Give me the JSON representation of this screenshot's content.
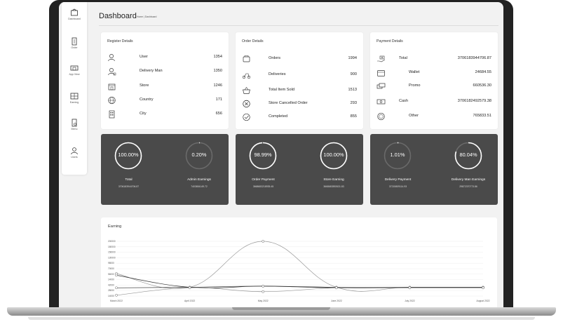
{
  "page": {
    "title": "Dashboard",
    "breadcrumb": "Home  |  Dashboard"
  },
  "sidebar": [
    {
      "label": "Dashboard",
      "icon": "dashboard-icon"
    },
    {
      "label": "Order",
      "icon": "order-icon"
    },
    {
      "label": "App View",
      "icon": "app-view-icon"
    },
    {
      "label": "Earning",
      "icon": "earning-icon"
    },
    {
      "label": "Menu",
      "icon": "menu-icon"
    },
    {
      "label": "Users",
      "icon": "users-icon"
    }
  ],
  "register": {
    "title": "Register Details",
    "rows": [
      {
        "label": "User",
        "value": "1354",
        "icon": "user-icon"
      },
      {
        "label": "Delivery Man",
        "value": "1350",
        "icon": "delivery-man-icon"
      },
      {
        "label": "Store",
        "value": "1246",
        "icon": "store-icon"
      },
      {
        "label": "Country",
        "value": "171",
        "icon": "globe-icon"
      },
      {
        "label": "City",
        "value": "656",
        "icon": "city-icon"
      }
    ]
  },
  "orders": {
    "title": "Order Details",
    "rows": [
      {
        "label": "Orders",
        "value": "1994",
        "icon": "orders-icon"
      },
      {
        "label": "Deliveries",
        "value": "900",
        "icon": "deliveries-icon"
      },
      {
        "label": "Total Item Sold",
        "value": "1513",
        "icon": "basket-icon"
      },
      {
        "label": "Store Cancelled Order",
        "value": "293",
        "icon": "cancel-circle-icon"
      },
      {
        "label": "Completed",
        "value": "855",
        "icon": "check-circle-icon"
      }
    ]
  },
  "payment": {
    "title": "Payment Details",
    "rows": [
      {
        "label": "Total",
        "value": "3706183944706.87",
        "icon": "money-hand-icon"
      },
      {
        "label": "Wallet",
        "value": "24684.55",
        "icon": "wallet-icon"
      },
      {
        "label": "Promo",
        "value": "660536.30",
        "icon": "promo-icon"
      },
      {
        "label": "Cash",
        "value": "3706182492579.38",
        "icon": "cash-icon"
      },
      {
        "label": "Other",
        "value": "765833.51",
        "icon": "coin-icon"
      }
    ]
  },
  "rings": [
    {
      "percent_text": "100.00%",
      "fraction": 1.0,
      "title": "Total",
      "sub": "3706183944706.87"
    },
    {
      "percent_text": "0.20%",
      "fraction": 0.002,
      "title": "Admin Earnings",
      "sub": "7403654149.72"
    },
    {
      "percent_text": "98.99%",
      "fraction": 0.9899,
      "title": "Order Payment",
      "sub": "3668683218935.45"
    },
    {
      "percent_text": "100.00%",
      "fraction": 1.0,
      "title": "Store Earning",
      "sub": "3668683592631.83"
    },
    {
      "percent_text": "1.01%",
      "fraction": 0.0101,
      "title": "Delivery Payment",
      "sub": "37215809114.93"
    },
    {
      "percent_text": "80.04%",
      "fraction": 0.8004,
      "title": "Delivery Man Earnings",
      "sub": "29872370773.86"
    }
  ],
  "chart_data": {
    "type": "line",
    "title": "Earning",
    "categories": [
      "March 2022",
      "April 2022",
      "May 2022",
      "June 2022",
      "July 2022",
      "August 2022"
    ],
    "yticks": [
      "200000",
      "180000",
      "156000",
      "130000",
      "98000",
      "70000",
      "56000",
      "14000",
      "42000",
      "28000",
      "14000"
    ],
    "ylim": [
      0,
      200000
    ],
    "series": [
      {
        "values": [
          82000,
          32000,
          200000,
          32000,
          32000,
          32000
        ]
      },
      {
        "values": [
          76000,
          32000,
          36000,
          32000,
          32000,
          32000
        ]
      },
      {
        "values": [
          30000,
          32000,
          36000,
          30000,
          30000,
          30000
        ]
      },
      {
        "values": [
          3000,
          30000,
          16000,
          30000,
          30000,
          30000
        ]
      }
    ],
    "colors": {
      "line": "#999999",
      "dark_line": "#333333"
    }
  }
}
